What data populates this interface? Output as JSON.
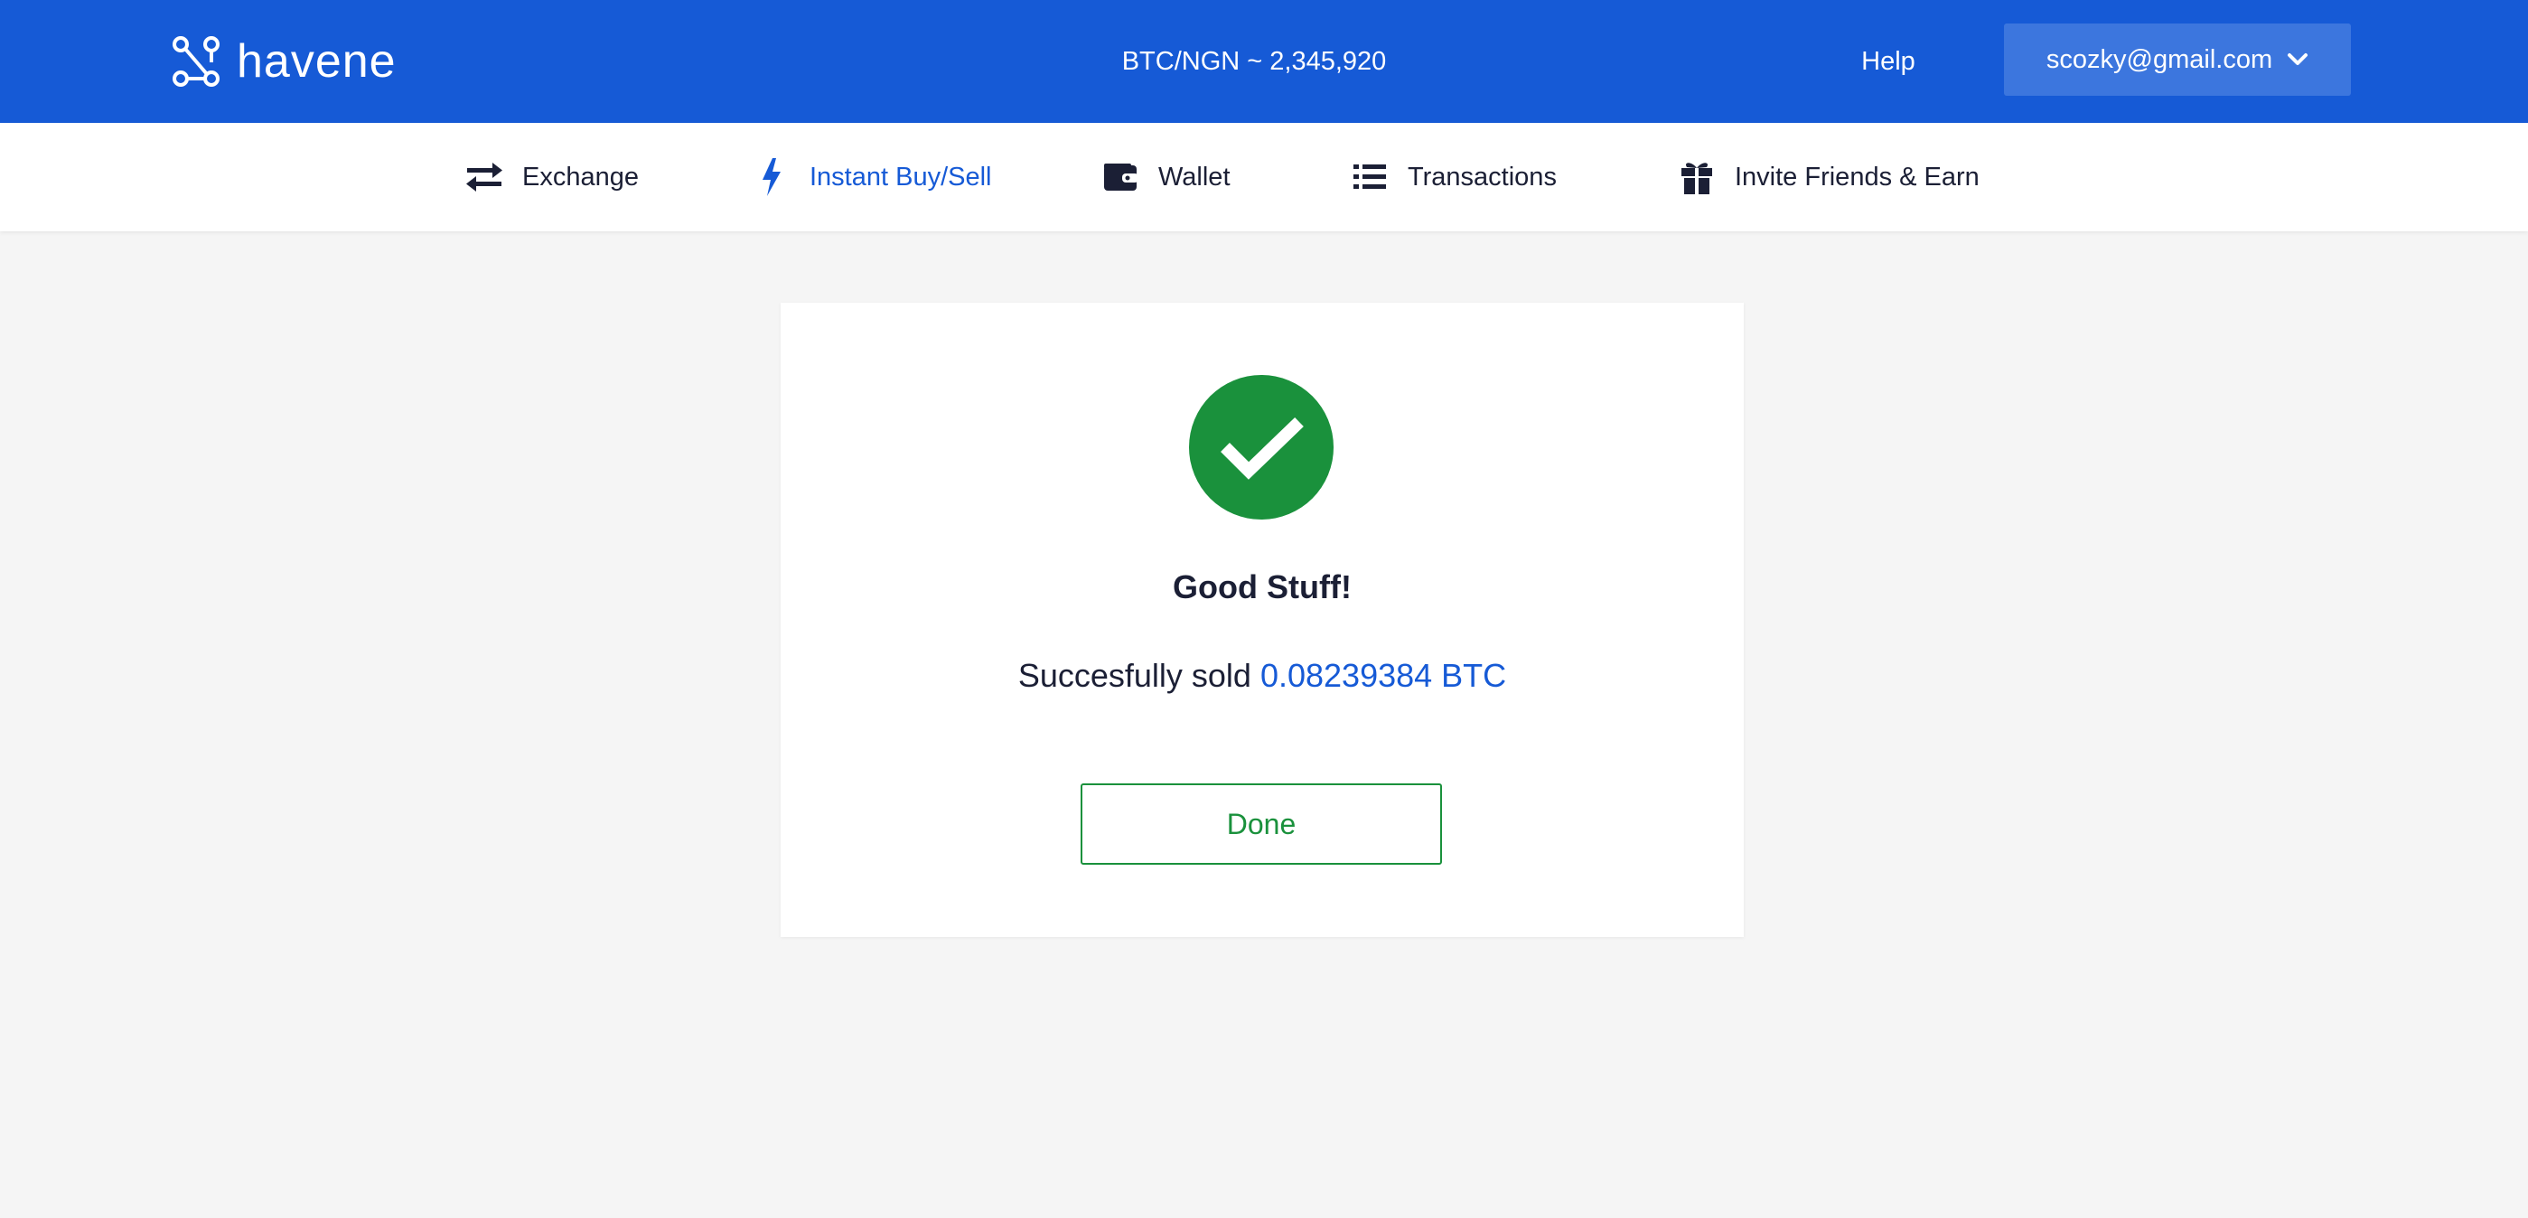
{
  "header": {
    "logo_text": "havene",
    "rate": "BTC/NGN ~ 2,345,920",
    "help_label": "Help",
    "account_email": "scozky@gmail.com",
    "accent_color": "#165ad6"
  },
  "nav": {
    "items": [
      {
        "label": "Exchange",
        "icon": "exchange-arrows-icon",
        "active": false
      },
      {
        "label": "Instant Buy/Sell",
        "icon": "lightning-icon",
        "active": true
      },
      {
        "label": "Wallet",
        "icon": "wallet-icon",
        "active": false
      },
      {
        "label": "Transactions",
        "icon": "list-icon",
        "active": false
      },
      {
        "label": "Invite Friends & Earn",
        "icon": "gift-icon",
        "active": false
      }
    ]
  },
  "success": {
    "icon": "checkmark-icon",
    "title": "Good Stuff!",
    "message_prefix": "Succesfully sold",
    "amount": "0.08239384 BTC",
    "done_label": "Done",
    "success_color": "#1a913c"
  }
}
